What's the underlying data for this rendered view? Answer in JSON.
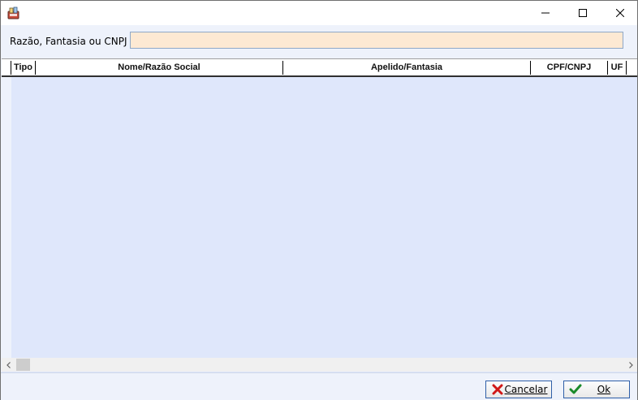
{
  "titlebar": {
    "app_icon": "app-icon",
    "minimize_icon": "minimize-icon",
    "maximize_icon": "maximize-icon",
    "close_icon": "close-icon"
  },
  "search": {
    "label": "Razão, Fantasia ou CNPJ",
    "value": "",
    "bg_color": "#fde9d3"
  },
  "grid": {
    "columns": [
      "Tipo",
      "Nome/Razão Social",
      "Apelido/Fantasia",
      "CPF/CNPJ",
      "UF"
    ],
    "rows": [],
    "body_color": "#dfe7fb"
  },
  "buttons": {
    "cancel_label": "Cancelar",
    "cancel_icon": "x-icon",
    "ok_label": "Ok",
    "ok_icon": "checkmark-icon"
  }
}
